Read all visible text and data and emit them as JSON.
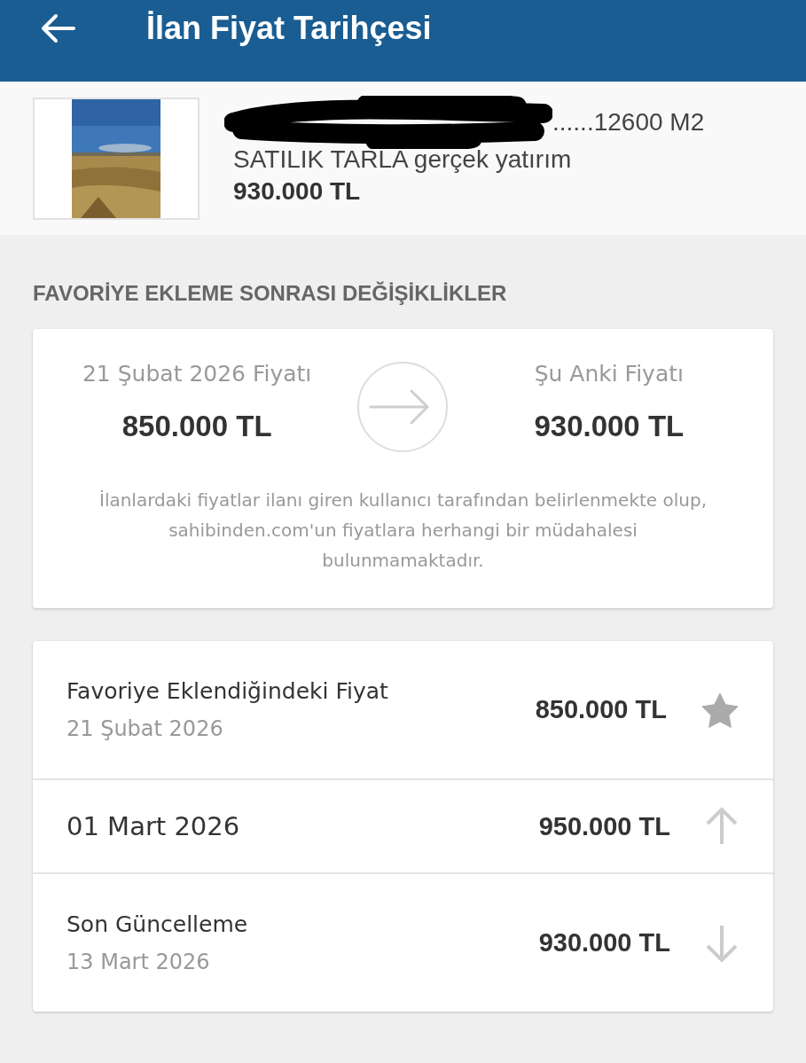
{
  "header": {
    "title": "İlan Fiyat Tarihçesi"
  },
  "listing": {
    "title_visible": "......12600 M2",
    "redacted": true,
    "subtitle": "SATILIK TARLA gerçek yatırım",
    "price": "930.000 TL"
  },
  "section_title": "FAVORİYE EKLEME SONRASI DEĞİŞİKLİKLER",
  "comparison": {
    "from_label": "21 Şubat 2026 Fiyatı",
    "from_price": "850.000 TL",
    "to_label": "Şu Anki Fiyatı",
    "to_price": "930.000 TL",
    "disclaimer": "İlanlardaki fiyatlar ilanı giren kullanıcı tarafından belirlenmekte olup, sahibinden.com'un fiyatlara herhangi bir müdahalesi bulunmamaktadır."
  },
  "history": [
    {
      "kind": "favorite",
      "label": "Favoriye Eklendiğindeki Fiyat",
      "date": "21 Şubat 2026",
      "price": "850.000 TL"
    },
    {
      "kind": "up",
      "date": "01 Mart 2026",
      "price": "950.000 TL"
    },
    {
      "kind": "down",
      "label": "Son Güncelleme",
      "date": "13 Mart 2026",
      "price": "930.000 TL"
    }
  ]
}
